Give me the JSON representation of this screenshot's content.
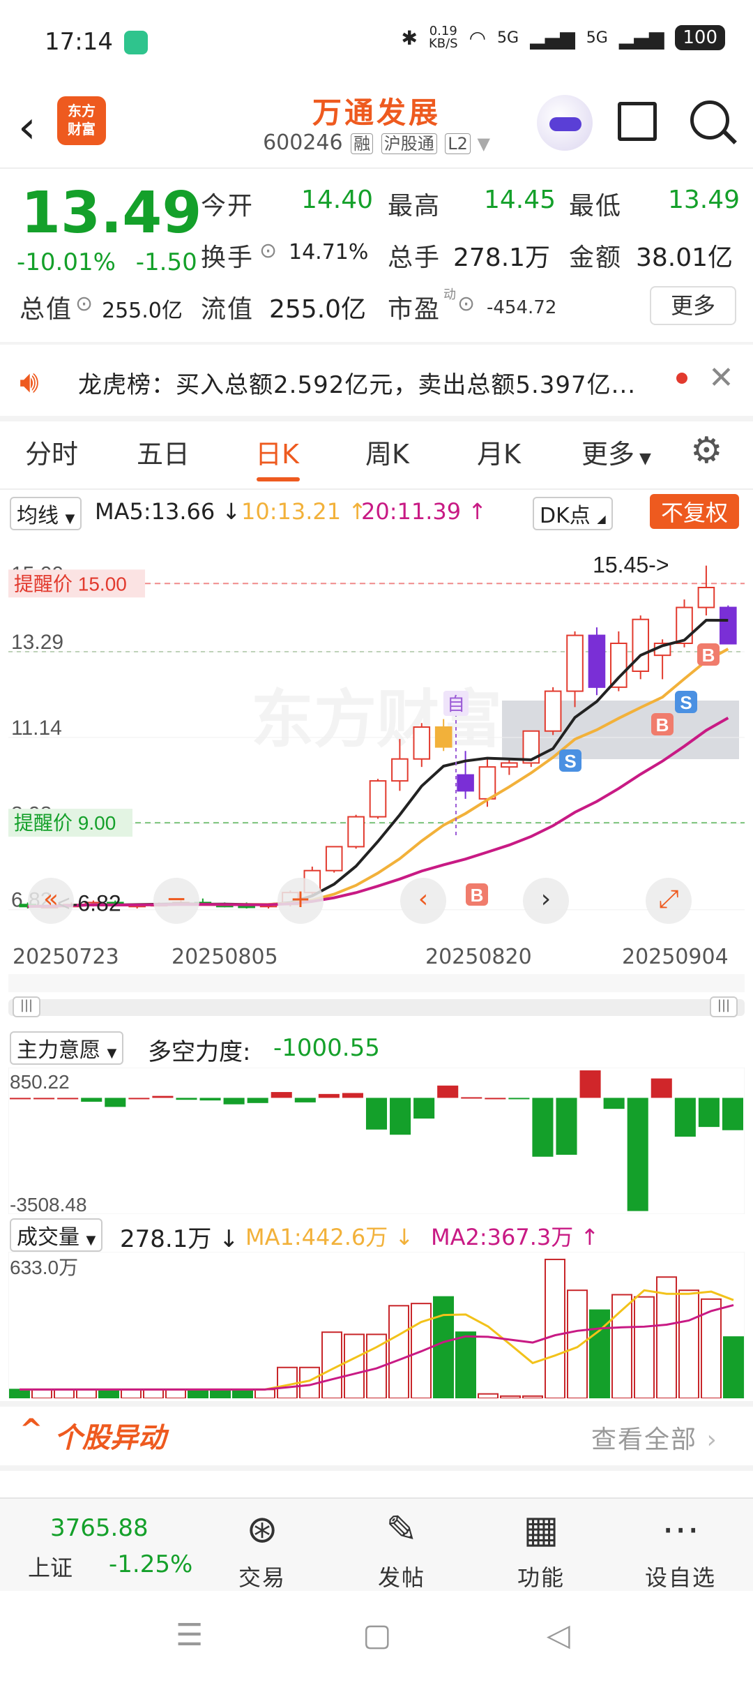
{
  "status_bar": {
    "time": "17:14",
    "net_speed_top": "0.19",
    "net_speed_bottom": "KB/S",
    "sig1": "5G",
    "sig2": "5G",
    "battery": "100"
  },
  "header": {
    "logo_top": "东方",
    "logo_bottom": "财富",
    "stock_name": "万通发展",
    "stock_code": "600246",
    "tags": [
      "融",
      "沪股通",
      "L2"
    ]
  },
  "quote": {
    "price": "13.49",
    "change_pct": "-10.01%",
    "change_abs": "-1.50",
    "fields": [
      {
        "label": "今开",
        "value": "14.40",
        "color": "#14a02a"
      },
      {
        "label": "最高",
        "value": "14.45",
        "color": "#14a02a"
      },
      {
        "label": "最低",
        "value": "13.49",
        "color": "#14a02a"
      },
      {
        "label": "换手",
        "value": "14.71%",
        "color": "#333333"
      },
      {
        "label": "总手",
        "value": "278.1万",
        "color": "#333333"
      },
      {
        "label": "金额",
        "value": "38.01亿",
        "color": "#333333"
      },
      {
        "label": "总值",
        "value": "255.0亿",
        "color": "#333333"
      },
      {
        "label": "流值",
        "value": "255.0亿",
        "color": "#333333"
      },
      {
        "label": "市盈",
        "value": "-454.72",
        "color": "#333333"
      }
    ],
    "pe_superscript": "动",
    "more": "更多"
  },
  "notice": {
    "text": "龙虎榜：买入总额2.592亿元，卖出总额5.397亿..."
  },
  "tabs": [
    "分时",
    "五日",
    "日K",
    "周K",
    "月K",
    "更多"
  ],
  "active_tab": "日K",
  "ma_row": {
    "selector": "均线",
    "ma5": "MA5:13.66",
    "ma10": "10:13.21",
    "ma20": "20:11.39",
    "dk": "DK点",
    "restore": "不复权"
  },
  "kchart": {
    "y_labels": [
      "15.00",
      "13.29",
      "11.14",
      "8.98",
      "6.82"
    ],
    "alert_high": "提醒价 15.00",
    "alert_low": "提醒价 9.00",
    "peak_label": "15.45->",
    "low_label": "<-6.82",
    "dates": [
      "20250723",
      "20250805",
      "20250820",
      "20250904"
    ],
    "markers": [
      {
        "text": "S",
        "color": "#4a90e2"
      },
      {
        "text": "S",
        "color": "#4a90e2"
      },
      {
        "text": "B",
        "color": "#f07c6c"
      },
      {
        "text": "B",
        "color": "#f07c6c"
      },
      {
        "text": "B",
        "color": "#f07c6c"
      }
    ],
    "self_tag": "自",
    "watermark": "东方财富"
  },
  "chart_data": [
    {
      "type": "candlestick",
      "title": "日K",
      "ylim": [
        6.5,
        15.6
      ],
      "categories_shown": [
        "20250723",
        "20250805",
        "20250820",
        "20250904"
      ],
      "ohlc": [
        [
          6.95,
          7.0,
          6.85,
          6.9
        ],
        [
          6.9,
          6.95,
          6.85,
          6.92
        ],
        [
          6.92,
          7.0,
          6.88,
          6.95
        ],
        [
          6.95,
          7.05,
          6.9,
          7.0
        ],
        [
          7.0,
          7.05,
          6.9,
          6.92
        ],
        [
          6.92,
          6.98,
          6.85,
          6.95
        ],
        [
          6.95,
          7.0,
          6.9,
          6.97
        ],
        [
          6.97,
          7.05,
          6.92,
          7.0
        ],
        [
          7.0,
          7.1,
          6.92,
          6.95
        ],
        [
          6.95,
          7.0,
          6.88,
          6.93
        ],
        [
          6.93,
          7.0,
          6.85,
          6.9
        ],
        [
          6.9,
          6.98,
          6.85,
          6.95
        ],
        [
          6.95,
          7.3,
          6.9,
          7.25
        ],
        [
          7.25,
          7.9,
          7.2,
          7.8
        ],
        [
          7.8,
          8.4,
          7.75,
          8.4
        ],
        [
          8.4,
          9.2,
          8.35,
          9.15
        ],
        [
          9.15,
          10.1,
          9.1,
          10.05
        ],
        [
          10.05,
          11.1,
          9.8,
          10.6
        ],
        [
          10.6,
          11.5,
          10.4,
          11.4
        ],
        [
          11.4,
          11.6,
          10.8,
          10.9
        ],
        [
          10.2,
          10.8,
          9.6,
          9.8
        ],
        [
          9.6,
          10.6,
          9.4,
          10.4
        ],
        [
          10.4,
          10.6,
          10.2,
          10.5
        ],
        [
          10.5,
          11.2,
          10.4,
          11.3
        ],
        [
          11.3,
          12.4,
          11.2,
          12.3
        ],
        [
          12.3,
          13.8,
          11.9,
          13.7
        ],
        [
          13.7,
          13.9,
          12.2,
          12.4
        ],
        [
          12.4,
          13.8,
          12.3,
          13.5
        ],
        [
          12.8,
          14.2,
          12.6,
          14.1
        ],
        [
          13.2,
          13.6,
          12.6,
          13.5
        ],
        [
          13.5,
          14.6,
          13.4,
          14.4
        ],
        [
          14.4,
          15.45,
          14.2,
          14.9
        ],
        [
          14.4,
          14.45,
          13.49,
          13.49
        ]
      ],
      "series": [
        {
          "name": "MA5",
          "last": 13.66
        },
        {
          "name": "MA10",
          "last": 13.21
        },
        {
          "name": "MA20",
          "last": 11.39
        }
      ]
    },
    {
      "type": "bar",
      "title": "主力意愿",
      "indicator_label": "多空力度:",
      "indicator_value": "-1000.55",
      "ylim": [
        -3508.48,
        850.22
      ],
      "values": [
        0,
        0,
        0,
        -120,
        -280,
        0,
        60,
        -60,
        -80,
        -200,
        -160,
        180,
        -140,
        120,
        150,
        -980,
        -1140,
        -640,
        380,
        20,
        0,
        -40,
        -1820,
        -1760,
        850,
        -340,
        -3500,
        600,
        -1200,
        -900,
        -1000
      ]
    },
    {
      "type": "bar",
      "title": "成交量",
      "unit": "万",
      "ylim": [
        0,
        633.0
      ],
      "last_volume": "278.1万",
      "ma1": "MA1:442.6万",
      "ma2": "MA2:367.3万",
      "values": [
        40,
        40,
        40,
        40,
        40,
        40,
        40,
        40,
        40,
        40,
        40,
        40,
        140,
        140,
        300,
        290,
        290,
        420,
        430,
        460,
        300,
        20,
        10,
        10,
        630,
        490,
        400,
        470,
        460,
        550,
        490,
        450,
        278.1
      ]
    }
  ],
  "main_force": {
    "selector": "主力意愿",
    "label": "多空力度:",
    "value": "-1000.55",
    "y_top": "850.22",
    "y_bottom": "-3508.48"
  },
  "volume": {
    "selector": "成交量",
    "value": "278.1万",
    "ma1": "MA1:442.6万",
    "ma2": "MA2:367.3万",
    "y_top": "633.0万"
  },
  "alerts": {
    "title": "个股异动",
    "view_all": "查看全部"
  },
  "bottom_nav": {
    "index_value": "3765.88",
    "index_name": "上证",
    "index_change": "-1.25%",
    "items": [
      "交易",
      "发帖",
      "功能",
      "设自选"
    ]
  },
  "colors": {
    "brand": "#ee5a1f",
    "up": "#e23a2e",
    "down": "#14a02a",
    "ma5": "#222222",
    "ma10": "#f2b13a",
    "ma20": "#c81a84"
  }
}
